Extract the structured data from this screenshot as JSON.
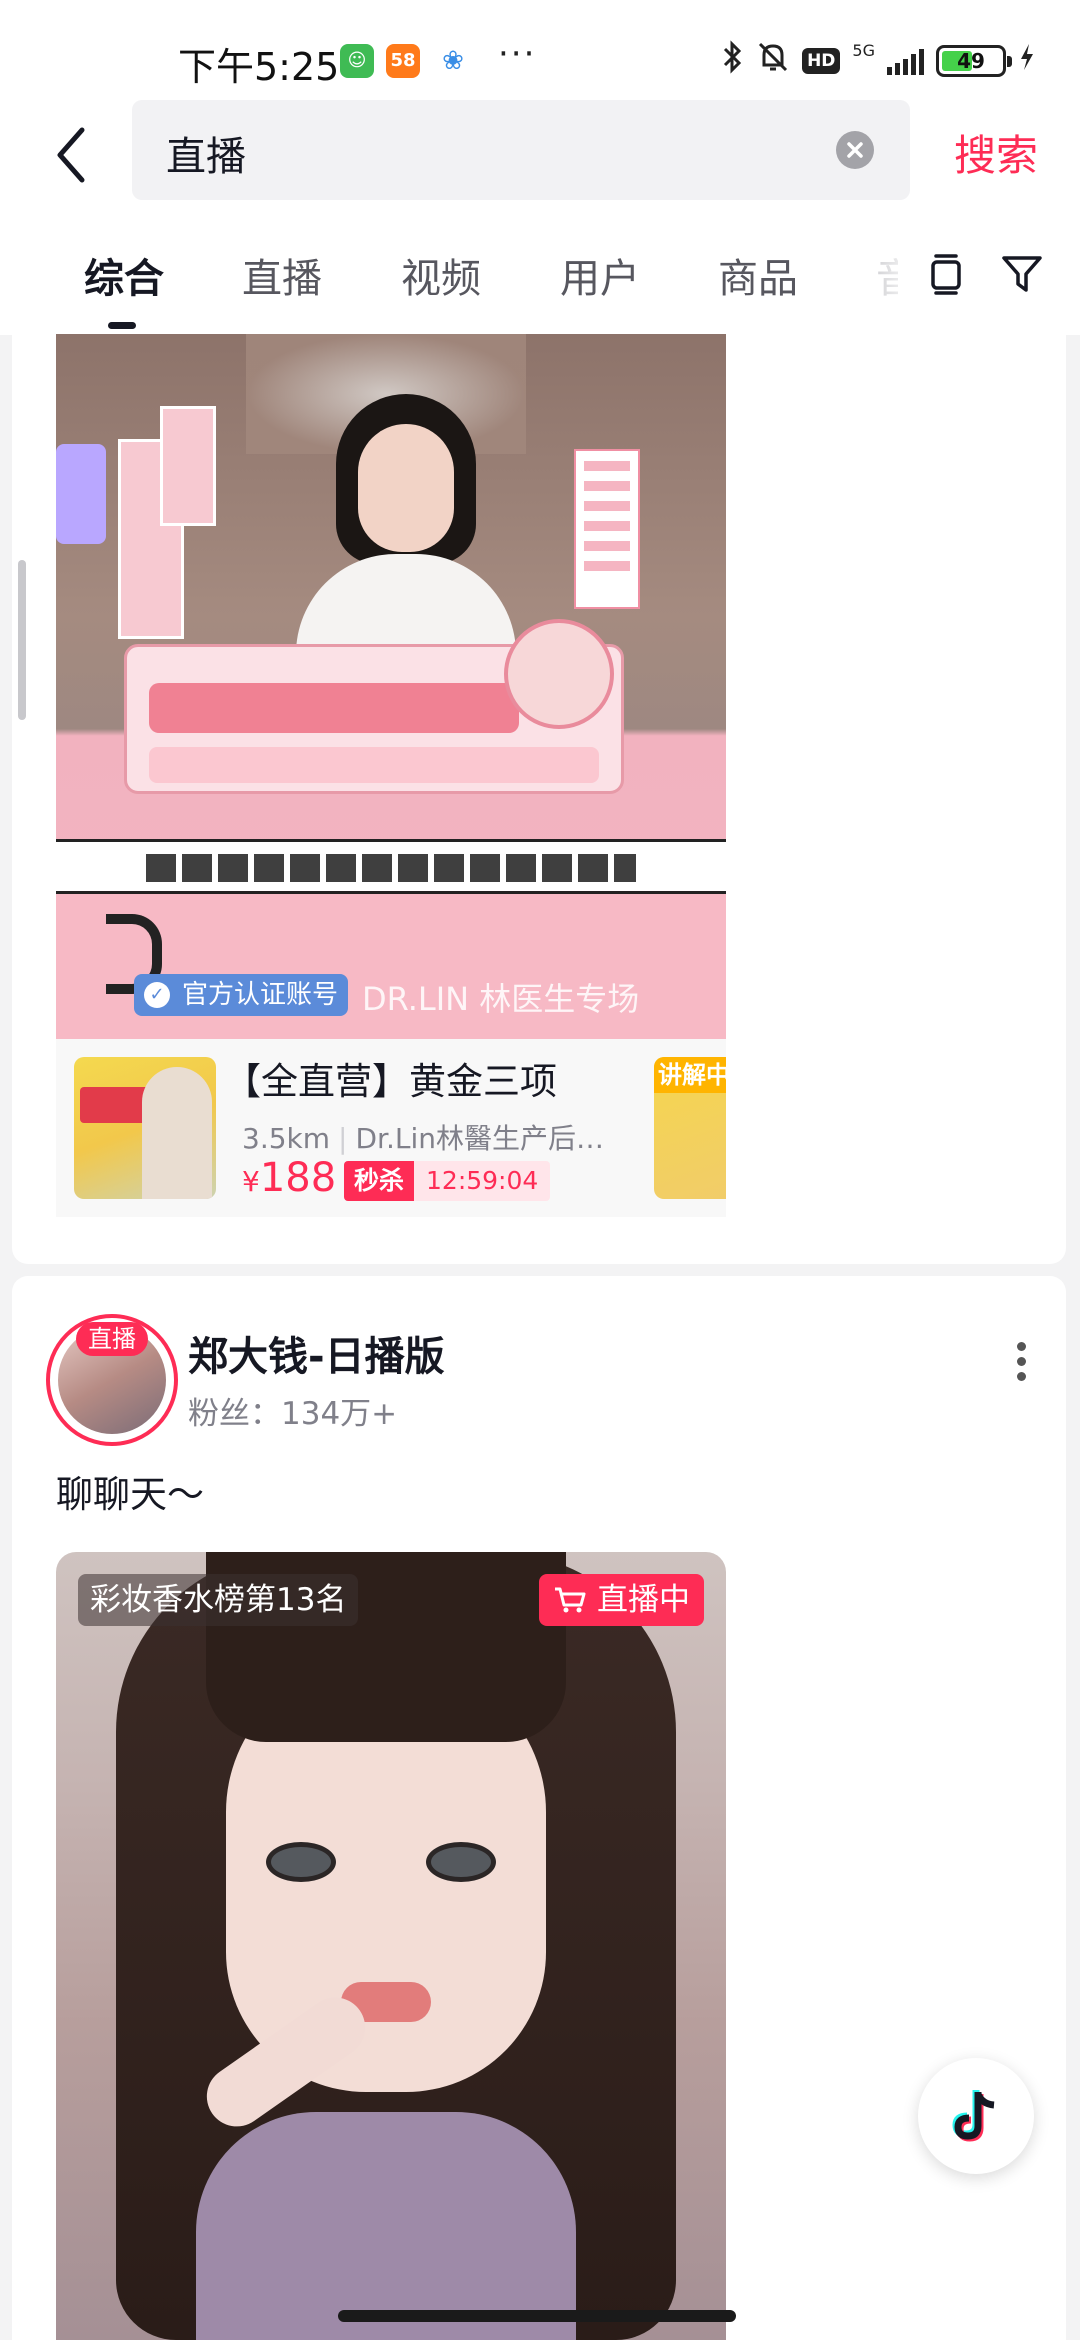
{
  "status_bar": {
    "time": "下午5:25",
    "app_58_label": "58",
    "more_dots": "···",
    "hd": "HD",
    "network": "5G",
    "battery": "49"
  },
  "search": {
    "query": "直播",
    "button_label": "搜索"
  },
  "tabs": [
    {
      "label": "综合",
      "active": true
    },
    {
      "label": "直播",
      "active": false
    },
    {
      "label": "视频",
      "active": false
    },
    {
      "label": "用户",
      "active": false
    },
    {
      "label": "商品",
      "active": false
    },
    {
      "label": "音",
      "active": false
    }
  ],
  "card1": {
    "verified_label": "官方认证账号",
    "overlay_name": "DR.LIN 林医生专场",
    "product": {
      "title": "【全直营】黄金三项",
      "distance": "3.5km",
      "shop": "Dr.Lin林醫生产后…",
      "price_symbol": "¥",
      "price": "188",
      "flash_label": "秒杀",
      "countdown": "12:59:04",
      "next_label": "讲解中"
    }
  },
  "card2": {
    "live_badge": "直播",
    "user_name": "郑大钱-日播版",
    "fans": "粉丝：134万+",
    "description": "聊聊天～",
    "rank_tag": "彩妆香水榜第13名",
    "live_tag": "直播中"
  },
  "colors": {
    "brand_red": "#fe2c55",
    "text_primary": "#161823",
    "text_secondary": "#80808a"
  }
}
